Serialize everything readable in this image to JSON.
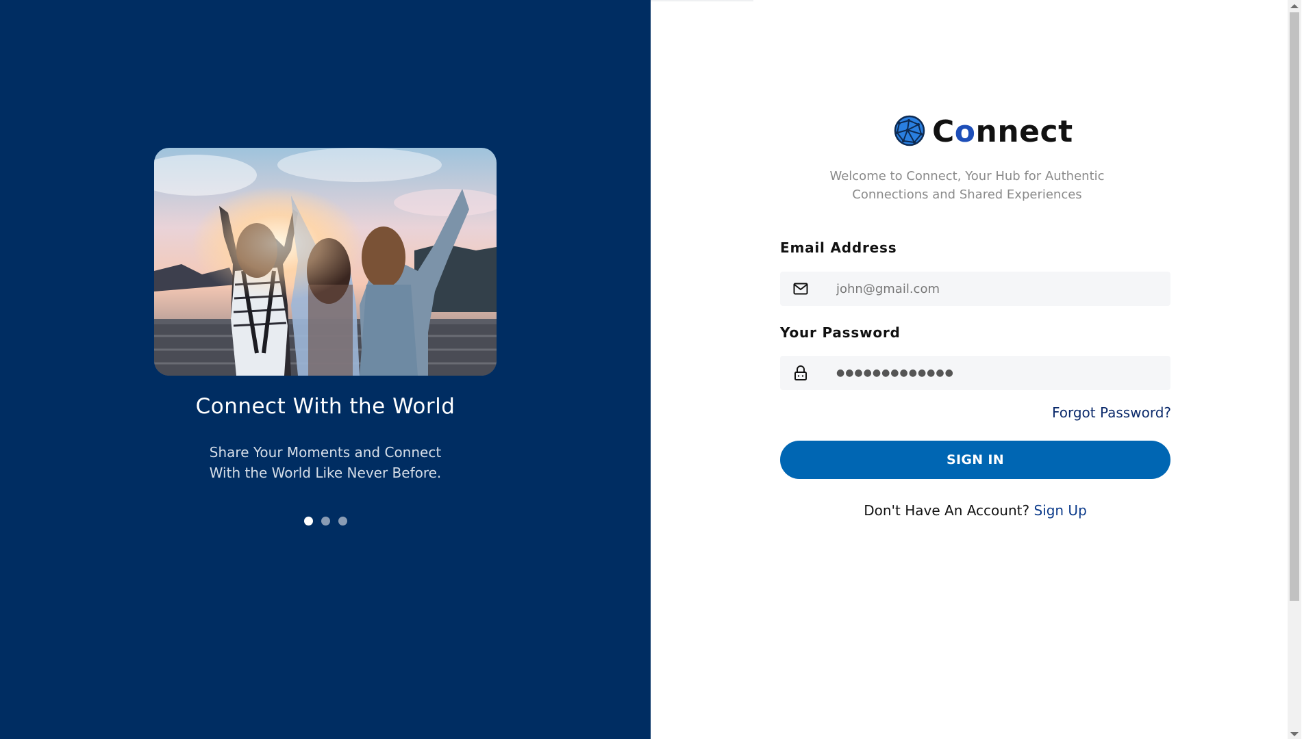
{
  "hero": {
    "title": "Connect With the World",
    "subtitle_line1": "Share Your Moments and Connect",
    "subtitle_line2": "With the World Like Never Before.",
    "carousel_dots": 3,
    "active_dot": 0
  },
  "brand": {
    "name_c": "C",
    "name_o": "o",
    "name_rest": "nnect",
    "welcome_line1": "Welcome to Connect, Your Hub for Authentic",
    "welcome_line2": "Connections and Shared Experiences"
  },
  "form": {
    "email_label": "Email Address",
    "email_placeholder": "john@gmail.com",
    "email_icon": "mail-icon",
    "password_label": "Your Password",
    "password_value": "●●●●●●●●●●●●●",
    "password_icon": "lock-icon",
    "forgot_label": "Forgot Password?",
    "signin_label": "SIGN IN",
    "no_account_text": "Don't Have An Account?",
    "signup_label": "Sign Up"
  },
  "colors": {
    "left_bg": "#002d62",
    "primary_button": "#0066b3",
    "link": "#0b2a6b",
    "brand_accent": "#1d4eb8"
  }
}
